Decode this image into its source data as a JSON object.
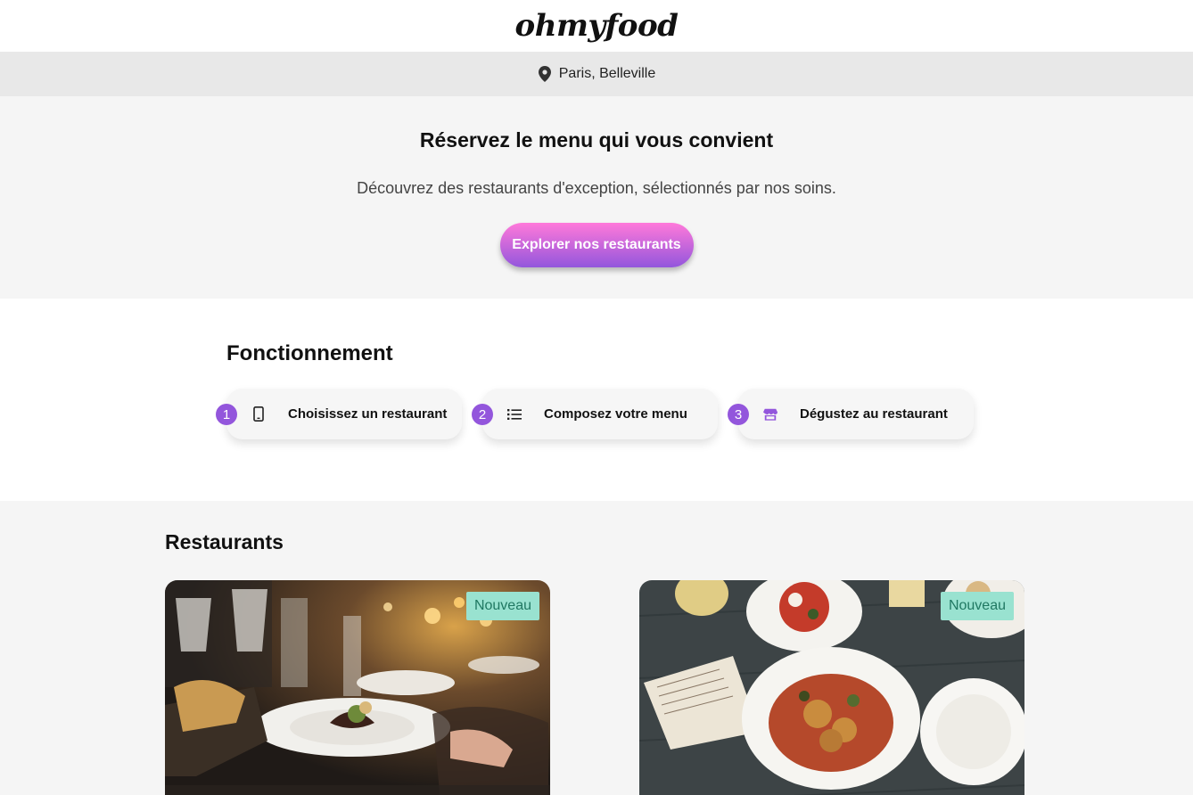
{
  "header": {
    "logo": "ohmyfood"
  },
  "location": {
    "text": "Paris, Belleville",
    "icon": "map-pin-icon"
  },
  "hero": {
    "title": "Réservez le menu qui vous convient",
    "subtitle": "Découvrez des restaurants d'exception, sélectionnés par nos soins.",
    "cta_label": "Explorer nos restaurants"
  },
  "how": {
    "title": "Fonctionnement",
    "steps": [
      {
        "num": "1",
        "icon": "mobile-phone-icon",
        "label": "Choisissez un restaurant"
      },
      {
        "num": "2",
        "icon": "list-icon",
        "label": "Composez votre menu"
      },
      {
        "num": "3",
        "icon": "store-icon",
        "label": "Dégustez au restaurant"
      }
    ]
  },
  "restaurants": {
    "title": "Restaurants",
    "cards": [
      {
        "badge": "Nouveau"
      },
      {
        "badge": "Nouveau"
      }
    ]
  },
  "colors": {
    "accent": "#9356dc",
    "accent_pink": "#ff79da",
    "badge_bg": "#99e2d0",
    "badge_text": "#207862"
  }
}
